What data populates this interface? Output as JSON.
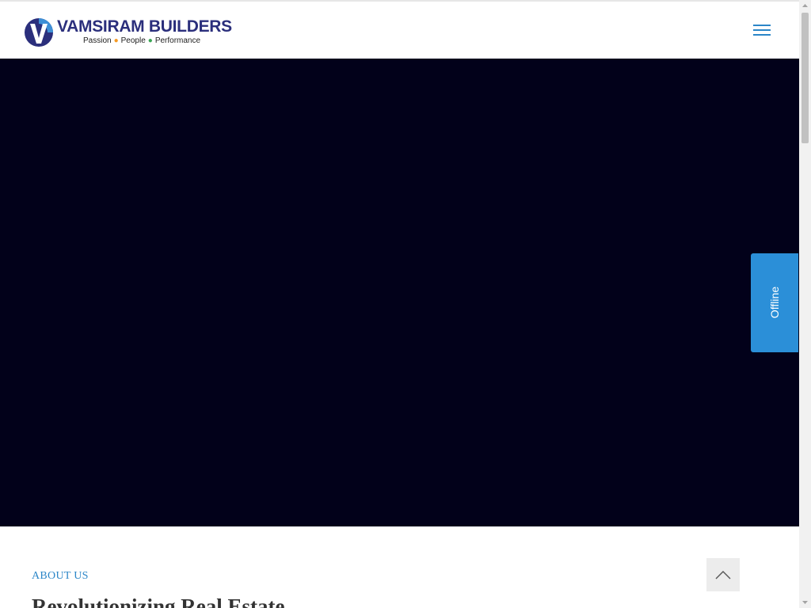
{
  "header": {
    "logo": {
      "name": "VAMSIRAM BUILDERS",
      "tagline": [
        "Passion",
        "People",
        "Performance"
      ],
      "icon": "v-logo-icon"
    },
    "menu_icon": "hamburger-menu-icon"
  },
  "hero": {
    "background_color": "#02011a"
  },
  "chat_widget": {
    "status_label": "Offline",
    "color": "#2b8fd8"
  },
  "about": {
    "eyebrow": "ABOUT US",
    "title": "Revolutionizing Real Estate"
  },
  "back_to_top": {
    "icon": "chevron-up-icon"
  },
  "colors": {
    "brand_navy": "#2b2f7c",
    "accent_blue": "#2b86c8"
  }
}
